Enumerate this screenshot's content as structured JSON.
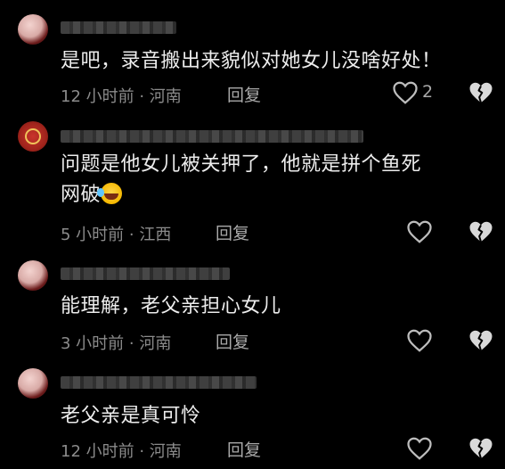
{
  "comments": [
    {
      "text": "是吧，录音搬出来貌似对她女儿没啥好处！",
      "meta": "12 小时前 · 河南",
      "reply_label": "回复",
      "like_count": "2"
    },
    {
      "text_line1": "问题是他女儿被关押了，他就是拼个鱼死",
      "text_line2": "网破",
      "meta": "5 小时前 · 江西",
      "reply_label": "回复"
    },
    {
      "text": "能理解，老父亲担心女儿",
      "meta": "3 小时前 · 河南",
      "reply_label": "回复"
    },
    {
      "text": "老父亲是真可怜",
      "meta": "12 小时前 · 河南",
      "reply_label": "回复"
    }
  ],
  "icons": {
    "like": "heart-outline-icon",
    "dislike": "broken-heart-icon",
    "emoji": "rofl-emoji"
  }
}
